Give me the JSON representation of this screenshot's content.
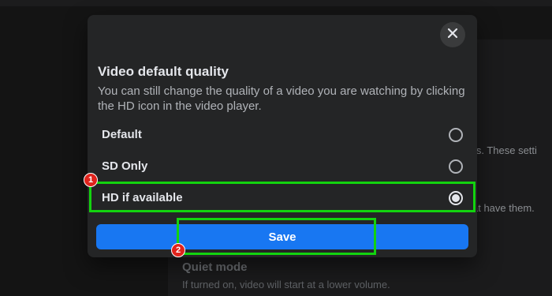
{
  "modal": {
    "title": "Video default quality",
    "description": "You can still change the quality of a video you are watching by clicking the HD icon in the video player.",
    "options": [
      {
        "label": "Default",
        "selected": false
      },
      {
        "label": "SD Only",
        "selected": false
      },
      {
        "label": "HD if available",
        "selected": true
      }
    ],
    "save_label": "Save",
    "close_icon": "close-icon"
  },
  "annotations": {
    "badge_1": "1",
    "badge_2": "2",
    "highlight_color": "#13d30f",
    "badge_color": "#e0231c"
  },
  "background": {
    "text_1": "ats. These setti",
    "text_2": "at have them.",
    "section_heading": "Quiet mode",
    "section_desc": "If turned on, video will start at a lower volume."
  },
  "colors": {
    "accent": "#1877f2",
    "modal_bg": "#242526",
    "page_bg": "#141414"
  }
}
